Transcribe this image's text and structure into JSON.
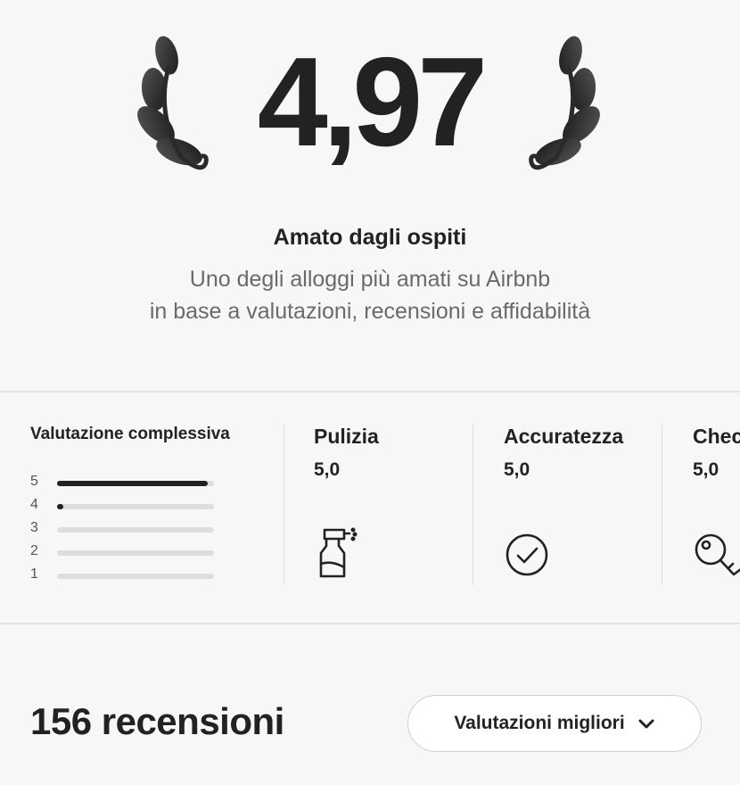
{
  "rating": {
    "value": "4,97",
    "title": "Amato dagli ospiti",
    "subtitle_line1": "Uno degli alloggi più amati su Airbnb",
    "subtitle_line2": "in base a valutazioni, recensioni e affidabilità"
  },
  "overall": {
    "title": "Valutazione complessiva",
    "histogram": [
      {
        "stars": "5",
        "fraction": 0.96
      },
      {
        "stars": "4",
        "fraction": 0.04
      },
      {
        "stars": "3",
        "fraction": 0.0
      },
      {
        "stars": "2",
        "fraction": 0.0
      },
      {
        "stars": "1",
        "fraction": 0.0
      }
    ]
  },
  "categories": [
    {
      "name": "Pulizia",
      "score": "5,0",
      "icon": "spray-bottle-icon"
    },
    {
      "name": "Accuratezza",
      "score": "5,0",
      "icon": "check-circle-icon"
    },
    {
      "name": "Check-in",
      "score": "5,0",
      "icon": "key-icon"
    }
  ],
  "reviews": {
    "title": "156 recensioni",
    "sort_label": "Valutazioni migliori"
  },
  "colors": {
    "text": "#222222",
    "muted": "#6a6a6a",
    "bar_fill": "#222222",
    "bar_track": "#dddddd",
    "background": "#f7f7f7"
  }
}
